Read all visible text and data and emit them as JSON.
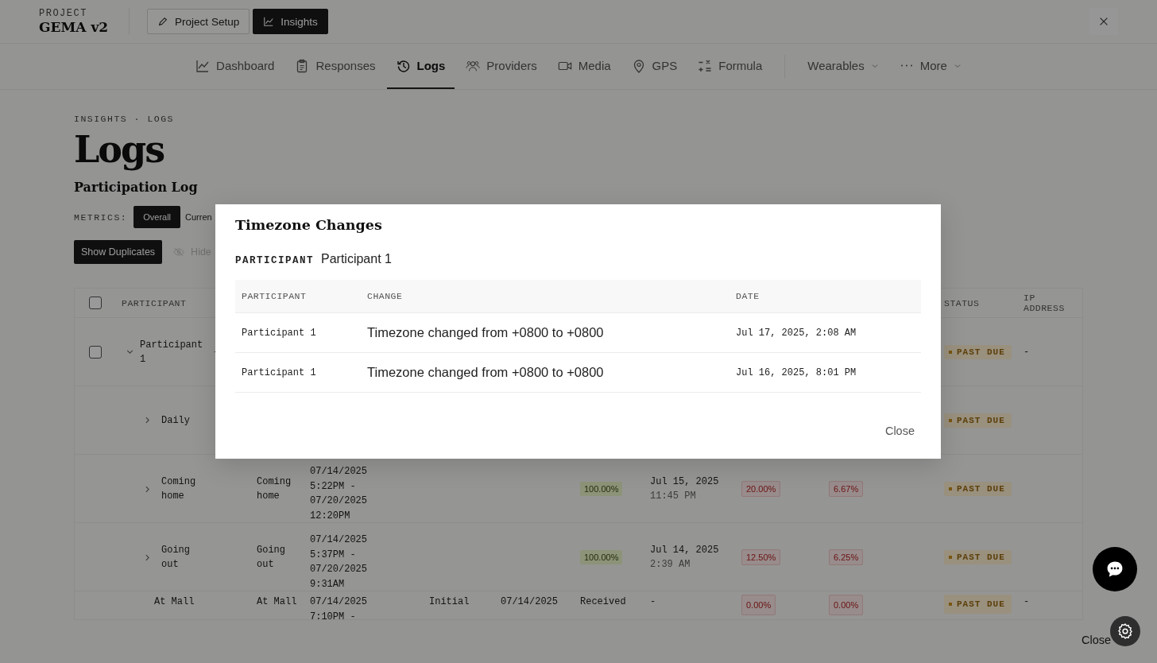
{
  "header": {
    "project_label": "PROJECT",
    "project_name": "GEMA v2",
    "modes": [
      {
        "label": "Project Setup",
        "selected": false
      },
      {
        "label": "Insights",
        "selected": true
      }
    ]
  },
  "nav": [
    {
      "label": "Dashboard",
      "selected": false,
      "dropdown": false
    },
    {
      "label": "Responses",
      "selected": false,
      "dropdown": false
    },
    {
      "label": "Logs",
      "selected": true,
      "dropdown": false
    },
    {
      "label": "Providers",
      "selected": false,
      "dropdown": false
    },
    {
      "label": "Media",
      "selected": false,
      "dropdown": false
    },
    {
      "label": "GPS",
      "selected": false,
      "dropdown": false
    },
    {
      "label": "Formula",
      "selected": false,
      "dropdown": false
    },
    {
      "label": "Wearables",
      "selected": false,
      "dropdown": true
    },
    {
      "label": "More",
      "selected": false,
      "dropdown": true
    }
  ],
  "breadcrumb": "INSIGHTS · LOGS",
  "title": "Logs",
  "section_title": "Participation Log",
  "metrics": {
    "label": "METRICS:",
    "options": [
      {
        "label": "Overall",
        "selected": true
      },
      {
        "label": "Curren",
        "selected": false
      }
    ]
  },
  "actions": [
    {
      "label": "Show Duplicates",
      "disabled": false
    },
    {
      "label": "Hide",
      "disabled": true
    }
  ],
  "table": {
    "select_all_checked": false,
    "columns": {
      "participant": "PARTICIPANT",
      "status": "STATUS",
      "ip_address": "IP ADDRESS"
    },
    "rows": [
      {
        "kind": "participant",
        "checked": false,
        "expanded": true,
        "name": "Participant 1",
        "column_2": "-",
        "status": {
          "text": "PAST DUE",
          "kind": "warning"
        },
        "ip_address": "-"
      },
      {
        "kind": "group",
        "expanded": false,
        "name": "Daily",
        "status": {
          "text": "PAST DUE",
          "kind": "warning"
        }
      },
      {
        "kind": "group",
        "expanded": false,
        "name": "Coming home",
        "column_2": "Coming home",
        "window": "07/14/2025 5:22PM - 07/20/2025 12:20PM",
        "column_6": {
          "text": "100.00%",
          "kind": "good"
        },
        "last_response": {
          "date": "Jul 15, 2025",
          "time": "11:45 PM"
        },
        "column_8": {
          "text": "20.00%",
          "kind": "bad"
        },
        "column_9": {
          "text": "6.67%",
          "kind": "bad"
        },
        "status": {
          "text": "PAST DUE",
          "kind": "warning"
        }
      },
      {
        "kind": "group",
        "expanded": false,
        "name": "Going out",
        "column_2": "Going out",
        "window": "07/14/2025 5:37PM - 07/20/2025 9:31AM",
        "column_6": {
          "text": "100.00%",
          "kind": "good"
        },
        "last_response": {
          "date": "Jul 14, 2025",
          "time": "2:39 AM"
        },
        "column_8": {
          "text": "12.50%",
          "kind": "bad"
        },
        "column_9": {
          "text": "6.25%",
          "kind": "bad"
        },
        "status": {
          "text": "PAST DUE",
          "kind": "warning"
        }
      },
      {
        "kind": "item",
        "name": "At Mall",
        "column_2": "At Mall",
        "window": "07/14/2025 7:10PM -",
        "column_4": "Initial",
        "column_5": "07/14/2025",
        "column_6": {
          "text": "Received",
          "kind": "plain"
        },
        "last_response": {
          "date": "-"
        },
        "column_8": {
          "text": "0.00%",
          "kind": "bad"
        },
        "column_9": {
          "text": "0.00%",
          "kind": "bad"
        },
        "status": {
          "text": "PAST DUE",
          "kind": "warning"
        },
        "ip_address": "-"
      }
    ]
  },
  "modal": {
    "title": "Timezone Changes",
    "participant_label": "PARTICIPANT",
    "participant": "Participant 1",
    "columns": [
      "PARTICIPANT",
      "CHANGE",
      "DATE"
    ],
    "rows": [
      {
        "participant": "Participant 1",
        "change": "Timezone changed from +0800 to +0800",
        "date": "Jul 17, 2025, 2:08 AM"
      },
      {
        "participant": "Participant 1",
        "change": "Timezone changed from +0800 to +0800",
        "date": "Jul 16, 2025, 8:01 PM"
      }
    ],
    "close": "Close"
  },
  "floating": {
    "close_label": "Close"
  }
}
